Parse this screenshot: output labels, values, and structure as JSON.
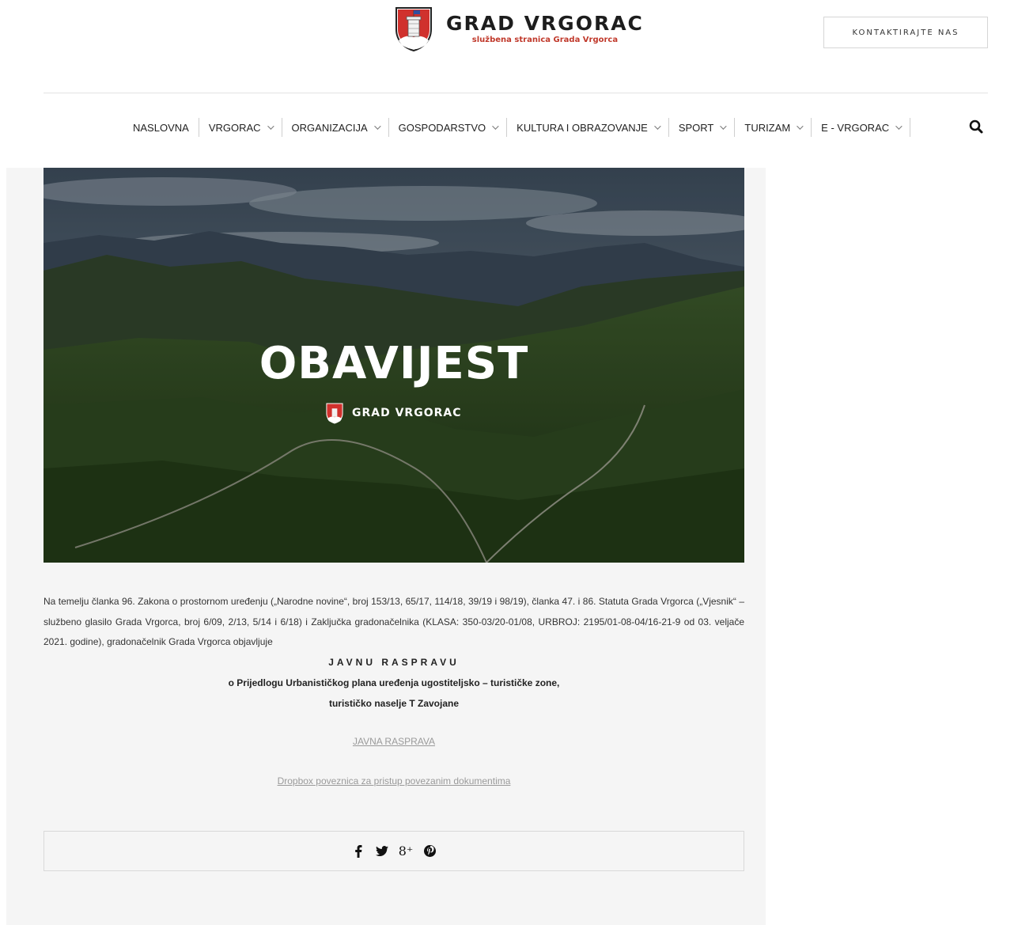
{
  "header": {
    "logo_title": "GRAD VRGORAC",
    "logo_subtitle": "službena stranica Grada Vrgorca",
    "contact_button": "KONTAKTIRAJTE NAS"
  },
  "nav": {
    "items": [
      {
        "label": "NASLOVNA",
        "has_dropdown": false
      },
      {
        "label": "VRGORAC",
        "has_dropdown": true
      },
      {
        "label": "ORGANIZACIJA",
        "has_dropdown": true
      },
      {
        "label": "GOSPODARSTVO",
        "has_dropdown": true
      },
      {
        "label": "KULTURA I OBRAZOVANJE",
        "has_dropdown": true
      },
      {
        "label": "SPORT",
        "has_dropdown": true
      },
      {
        "label": "TURIZAM",
        "has_dropdown": true
      },
      {
        "label": "E - VRGORAC",
        "has_dropdown": true
      }
    ],
    "search_icon": "search-icon"
  },
  "hero": {
    "title": "OBAVIJEST",
    "brand": "GRAD VRGORAC"
  },
  "article": {
    "body": "Na temelju članka 96. Zakona o prostornom uređenju („Narodne novine“, broj 153/13, 65/17, 114/18, 39/19 i 98/19), članka 47. i 86. Statuta Grada Vrgorca („Vjesnik“ – službeno glasilo Grada Vrgorca, broj 6/09, 2/13, 5/14 i 6/18) i Zaključka gradonačelnika (KLASA: 350-03/20-01/08, URBROJ: 2195/01-08-04/16-21-9 od 03. veljače 2021. godine), gradonačelnik Grada Vrgorca objavljuje",
    "heading": "JAVNU RASPRAVU",
    "subheading_1": "o Prijedlogu Urbanističkog plana uređenja ugostiteljsko – turističke zone,",
    "subheading_2": "turističko naselje T Zavojane",
    "link_1": "JAVNA RASPRAVA",
    "link_2": "Dropbox poveznica za pristup povezanim dokumentima"
  },
  "share": {
    "icons": [
      "facebook-icon",
      "twitter-icon",
      "google-plus-icon",
      "pinterest-icon"
    ]
  },
  "colors": {
    "brand_red": "#c0392b",
    "content_bg": "#f5f5f5",
    "link_grey": "#9a9a9a"
  }
}
